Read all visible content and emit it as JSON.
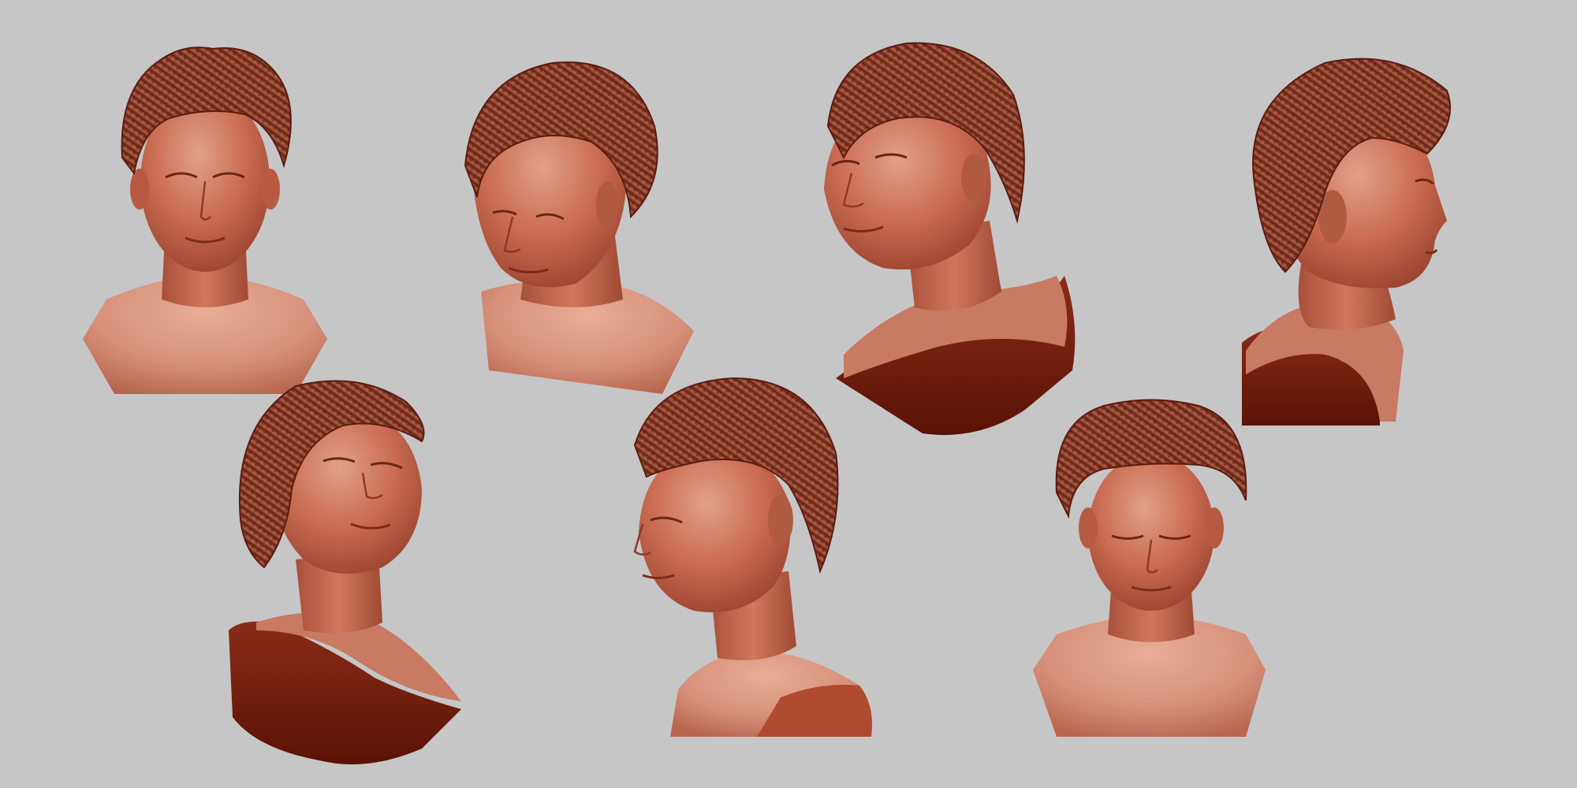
{
  "scene": {
    "background_color": "#c6c6c6",
    "material_colors": {
      "skin_light": "#d9907a",
      "skin_mid": "#c2654c",
      "skin_dark": "#8e3a27",
      "hair": "#9a4a36",
      "hair_dark": "#6a2618",
      "cut_face": "#7a2414",
      "cut_face_dark": "#5a1408"
    },
    "busts": [
      {
        "id": "bust-1",
        "view": "front"
      },
      {
        "id": "bust-2",
        "view": "three-quarter-left-down"
      },
      {
        "id": "bust-3",
        "view": "three-quarter-up-right"
      },
      {
        "id": "bust-4",
        "view": "right-profile"
      },
      {
        "id": "bust-5",
        "view": "low-angle-up-left"
      },
      {
        "id": "bust-6",
        "view": "left-three-quarter"
      },
      {
        "id": "bust-7",
        "view": "front-down"
      }
    ]
  }
}
